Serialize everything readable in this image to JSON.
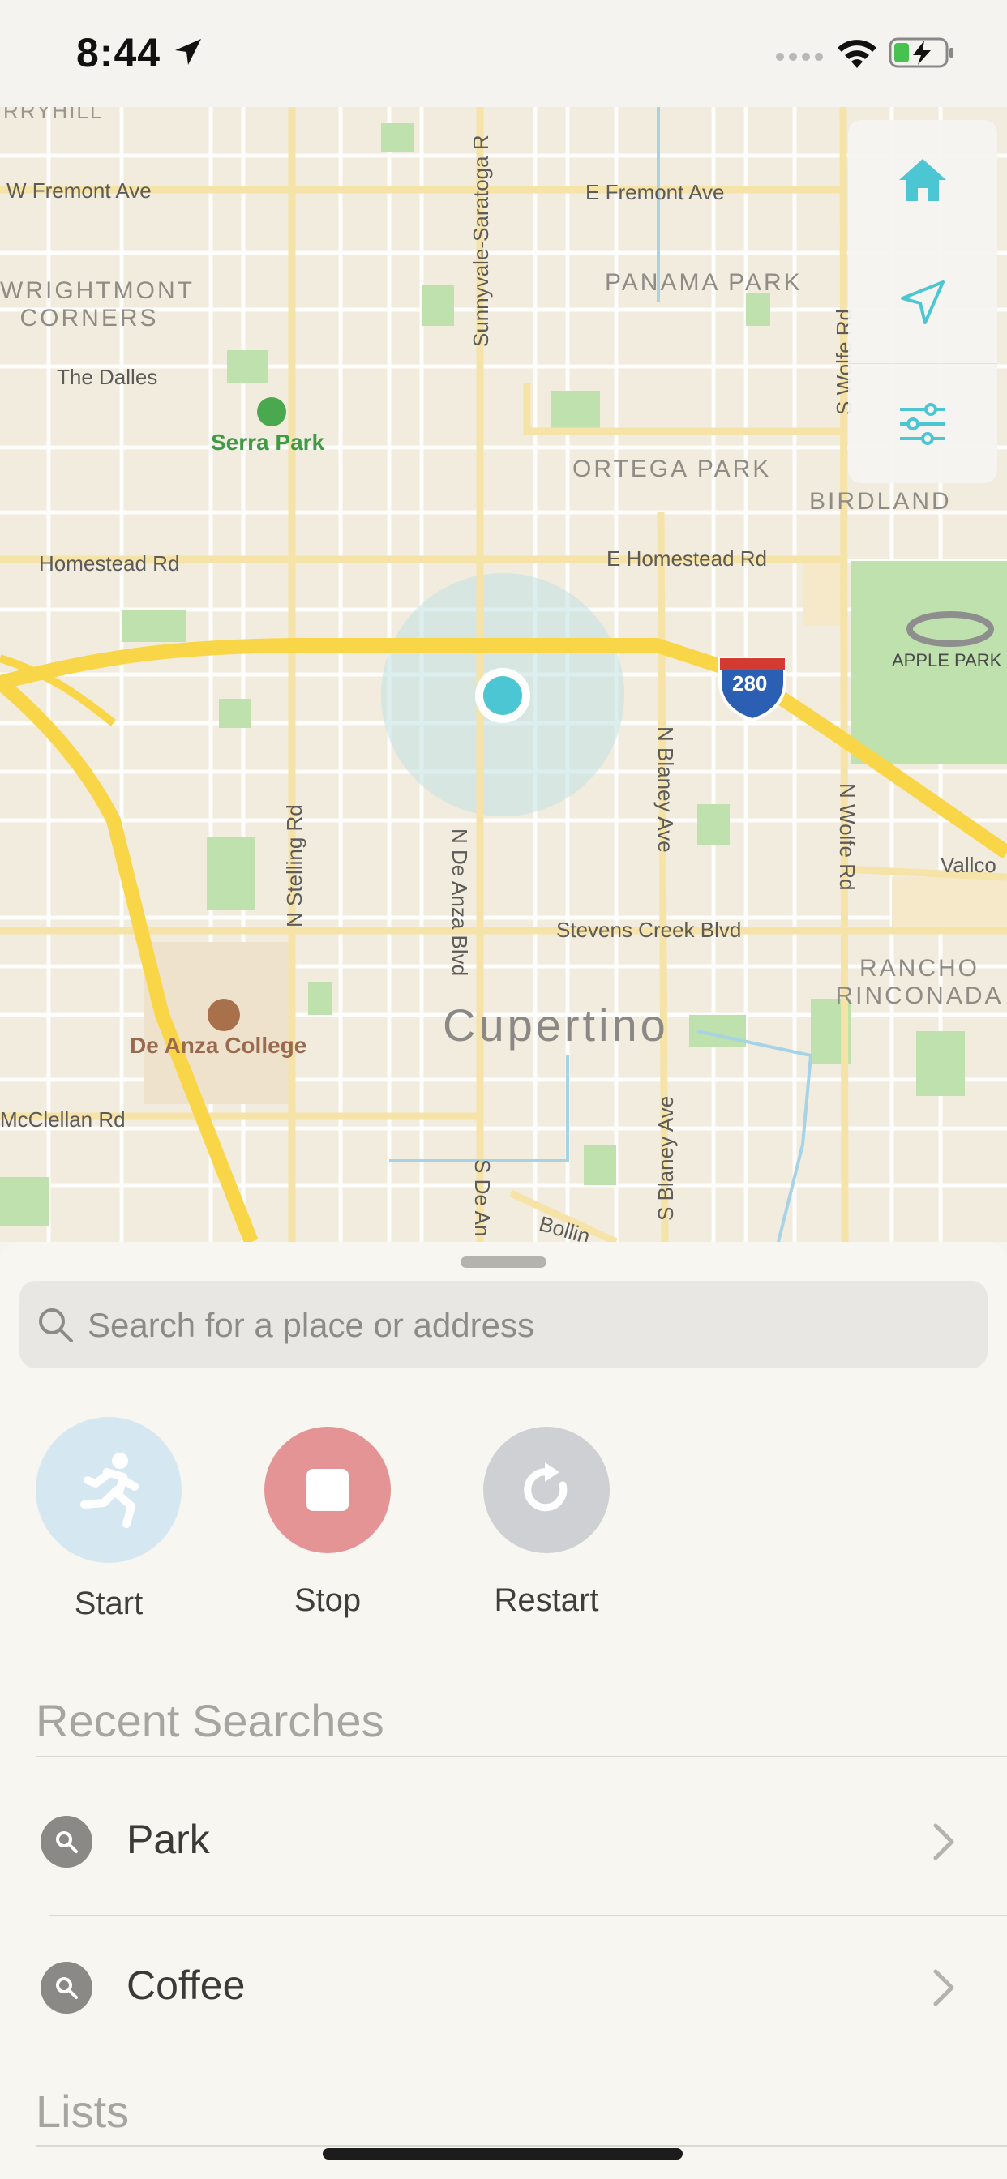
{
  "status_bar": {
    "time": "8:44"
  },
  "map": {
    "roads": {
      "w_fremont": "W Fremont Ave",
      "e_fremont": "E Fremont Ave",
      "the_dalles": "The Dalles",
      "homestead": "Homestead Rd",
      "e_homestead": "E Homestead Rd",
      "stevens_creek": "Stevens Creek Blvd",
      "mcclellan": "McClellan Rd",
      "vallco": "Vallco",
      "sunnyvale_saratoga": "Sunnyvale-Saratoga R",
      "n_de_anza": "N De Anza Blvd",
      "s_de_anza": "S De An",
      "n_stelling": "N Stelling Rd",
      "n_blaney": "N Blaney Ave",
      "s_blaney": "S Blaney Ave",
      "n_wolfe": "N Wolfe Rd",
      "s_wolfe": "S Wolfe Rd",
      "bollinger": "Bollin",
      "top_left": "RRYHILL",
      "interstate": "280"
    },
    "districts": {
      "wrightmont": "WRIGHTMONT\nCORNERS",
      "panama_park": "PANAMA PARK",
      "ortega_park": "ORTEGA PARK",
      "birdland": "BIRDLAND",
      "rancho": "RANCHO\nRINCONADA"
    },
    "places": {
      "serra_park": "Serra Park",
      "de_anza_college": "De Anza College",
      "apple_park": "APPLE PARK"
    },
    "city": "Cupertino"
  },
  "map_controls": [
    {
      "name": "home-icon"
    },
    {
      "name": "navigation-arrow-icon"
    },
    {
      "name": "sliders-icon"
    }
  ],
  "search": {
    "placeholder": "Search for a place or address"
  },
  "actions": {
    "start": {
      "label": "Start",
      "color": "#d5e8f1"
    },
    "stop": {
      "label": "Stop",
      "color": "#e59496"
    },
    "restart": {
      "label": "Restart",
      "color": "#cfd0d3"
    }
  },
  "recent_searches": {
    "title": "Recent Searches",
    "items": [
      {
        "label": "Park"
      },
      {
        "label": "Coffee"
      }
    ]
  },
  "lists": {
    "title": "Lists"
  },
  "colors": {
    "accent": "#4dc6d4",
    "highway": "#f9d648",
    "map_bg": "#f2ecdf",
    "park_green": "#b9dfa6"
  }
}
